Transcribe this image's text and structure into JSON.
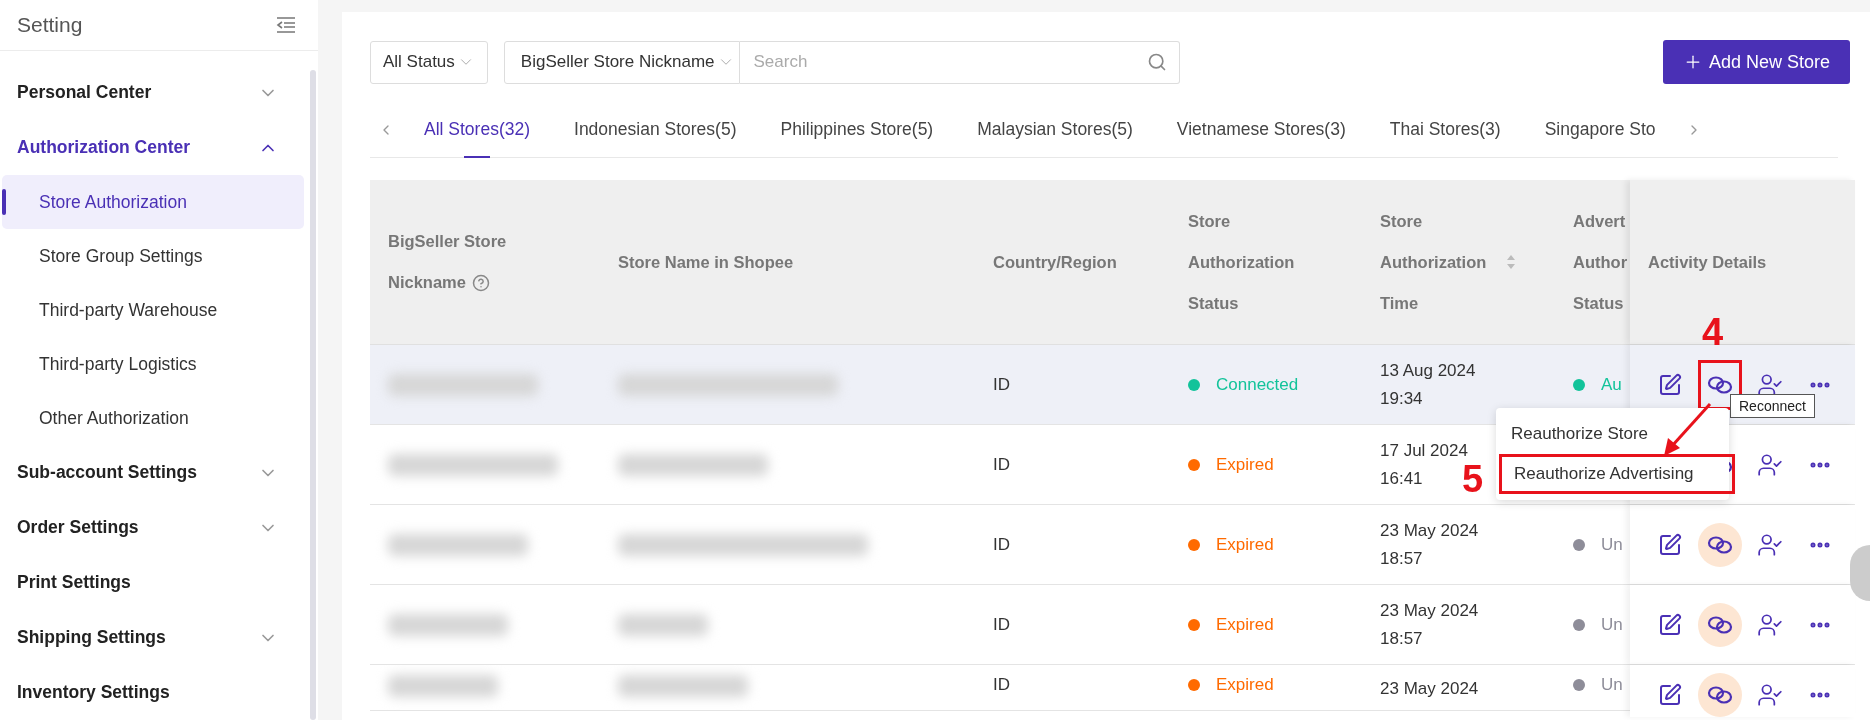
{
  "sidebar": {
    "title": "Setting",
    "items": [
      {
        "label": "Personal Center",
        "kind": "collapsible",
        "expanded": false
      },
      {
        "label": "Authorization Center",
        "kind": "collapsible",
        "expanded": true,
        "children": [
          {
            "label": "Store Authorization",
            "selected": true
          },
          {
            "label": "Store Group Settings",
            "selected": false
          },
          {
            "label": "Third-party Warehouse",
            "selected": false
          },
          {
            "label": "Third-party Logistics",
            "selected": false
          },
          {
            "label": "Other Authorization",
            "selected": false
          }
        ]
      },
      {
        "label": "Sub-account Settings",
        "kind": "collapsible",
        "expanded": false
      },
      {
        "label": "Order Settings",
        "kind": "collapsible",
        "expanded": false
      },
      {
        "label": "Print Settings",
        "kind": "plain",
        "expanded": false
      },
      {
        "label": "Shipping Settings",
        "kind": "collapsible",
        "expanded": false
      },
      {
        "label": "Inventory Settings",
        "kind": "plain",
        "expanded": false
      }
    ]
  },
  "filters": {
    "status": "All Status",
    "search_scope": "BigSeller Store Nickname",
    "search": {
      "placeholder": "Search"
    },
    "add_button": "Add New Store"
  },
  "tabs": [
    {
      "label": "All Stores(32)",
      "selected": true
    },
    {
      "label": "Indonesian Stores(5)",
      "selected": false
    },
    {
      "label": "Philippines Store(5)",
      "selected": false
    },
    {
      "label": "Malaysian Stores(5)",
      "selected": false
    },
    {
      "label": "Vietnamese Stores(3)",
      "selected": false
    },
    {
      "label": "Thai Stores(3)",
      "selected": false
    },
    {
      "label": "Singapore Sto",
      "selected": false
    }
  ],
  "table": {
    "columns": [
      {
        "lines": [
          "BigSeller Store",
          "Nickname"
        ],
        "kind": "help"
      },
      {
        "lines": [
          "Store Name in Shopee"
        ],
        "kind": "plain"
      },
      {
        "lines": [
          "Country/Region"
        ],
        "kind": "plain"
      },
      {
        "lines": [
          "Store",
          "Authorization",
          "Status"
        ],
        "kind": "plain"
      },
      {
        "lines": [
          "Store",
          "Authorization",
          "Time"
        ],
        "kind": "sortable"
      },
      {
        "lines": [
          "Advert",
          "Author",
          "Status"
        ],
        "kind": "plain"
      },
      {
        "lines": [
          "Activity Details"
        ],
        "kind": "plain"
      }
    ],
    "rows": [
      {
        "hovered": true,
        "country": "ID",
        "status": {
          "label": "Connected",
          "color": "#12c39a"
        },
        "date": "13 Aug 2024",
        "time": "19:34",
        "ad_status": {
          "label": "Au",
          "color": "#12c39a"
        },
        "reconnect": {
          "ringed": false,
          "marked": true,
          "callout": "4",
          "tooltip": "Reconnect"
        }
      },
      {
        "hovered": false,
        "country": "ID",
        "status": {
          "label": "Expired",
          "color": "#ff6a00"
        },
        "date": "17 Jul 2024",
        "time": "16:41",
        "reconnect": {
          "ringed": false,
          "marked": false
        }
      },
      {
        "hovered": false,
        "country": "ID",
        "status": {
          "label": "Expired",
          "color": "#ff6a00"
        },
        "date": "23 May 2024",
        "time": "18:57",
        "ad_status": {
          "label": "Un",
          "color": "#8e8d99"
        },
        "reconnect": {
          "ringed": true,
          "marked": false
        }
      },
      {
        "hovered": false,
        "country": "ID",
        "status": {
          "label": "Expired",
          "color": "#ff6a00"
        },
        "date": "23 May 2024",
        "time": "18:57",
        "ad_status": {
          "label": "Un",
          "color": "#8e8d99"
        },
        "reconnect": {
          "ringed": true,
          "marked": false
        }
      },
      {
        "hovered": false,
        "country": "ID",
        "status": {
          "label": "Expired",
          "color": "#ff6a00"
        },
        "date": "23 May 2024",
        "ad_status": {
          "label": "Un",
          "color": "#8e8d99"
        },
        "reconnect": {
          "ringed": true,
          "marked": false
        }
      }
    ]
  },
  "menu": {
    "callout": "5",
    "items": [
      {
        "label": "Reauthorize Store",
        "marked": false
      },
      {
        "label": "Reauthorize Advertising",
        "marked": true
      }
    ]
  }
}
